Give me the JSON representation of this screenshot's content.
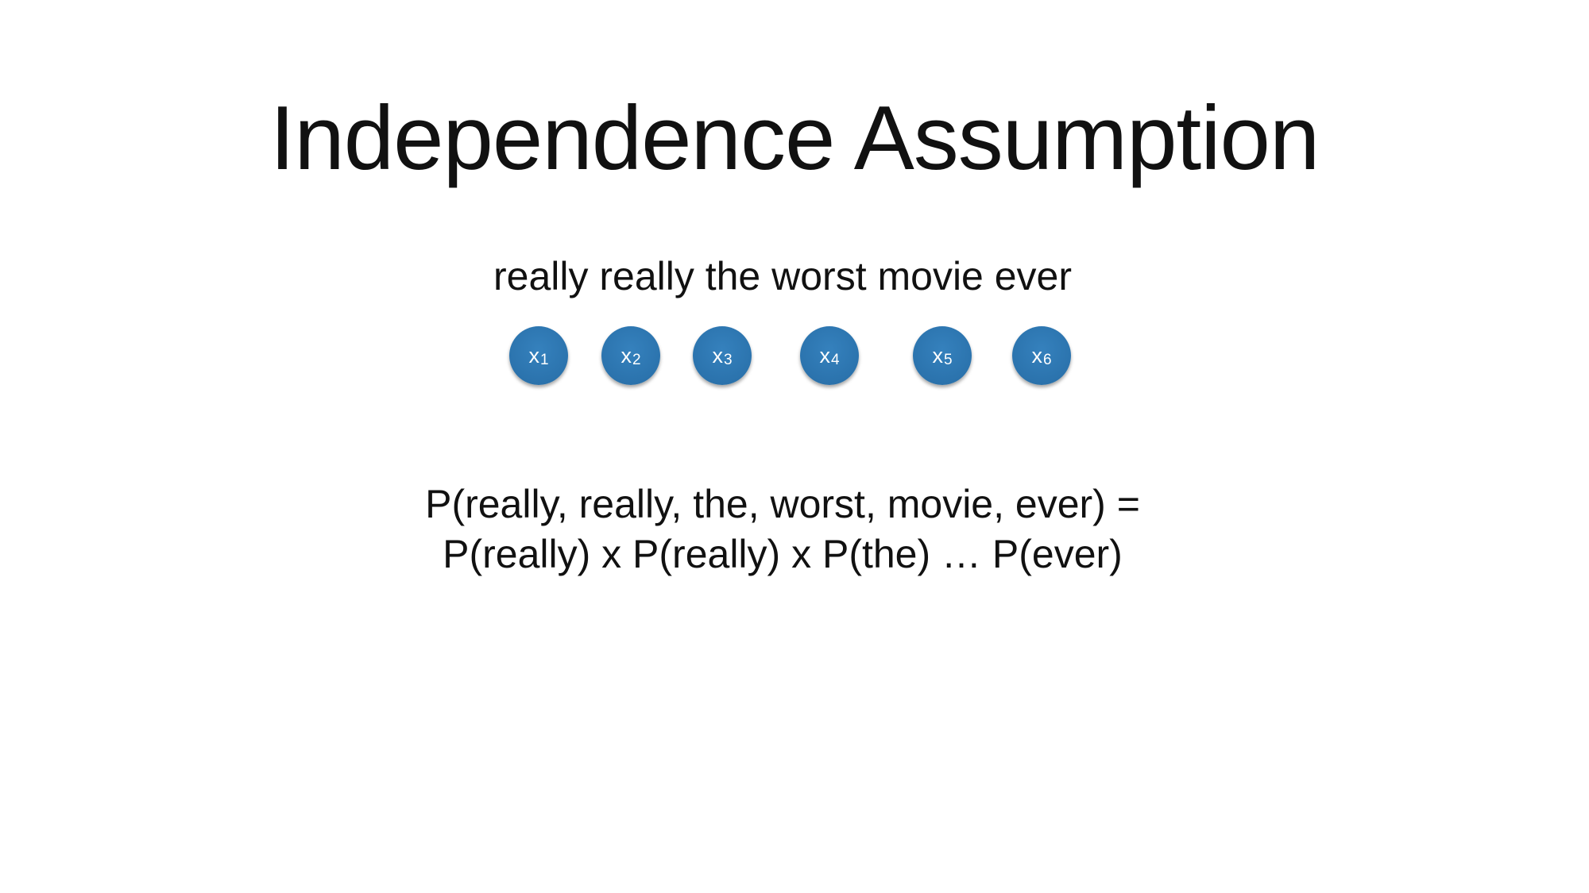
{
  "slide": {
    "title": "Independence Assumption",
    "sentence": "really really the worst movie ever",
    "nodes": [
      {
        "var": "x",
        "sub": "1"
      },
      {
        "var": "x",
        "sub": "2"
      },
      {
        "var": "x",
        "sub": "3"
      },
      {
        "var": "x",
        "sub": "4"
      },
      {
        "var": "x",
        "sub": "5"
      },
      {
        "var": "x",
        "sub": "6"
      }
    ],
    "formula": {
      "line1": "P(really, really, the, worst, movie, ever) =",
      "line2": "P(really) x P(really) x P(the) … P(ever)"
    }
  },
  "colors": {
    "node_fill": "#2e78b3",
    "node_text": "#ffffff",
    "text": "#111111",
    "background": "#ffffff"
  }
}
